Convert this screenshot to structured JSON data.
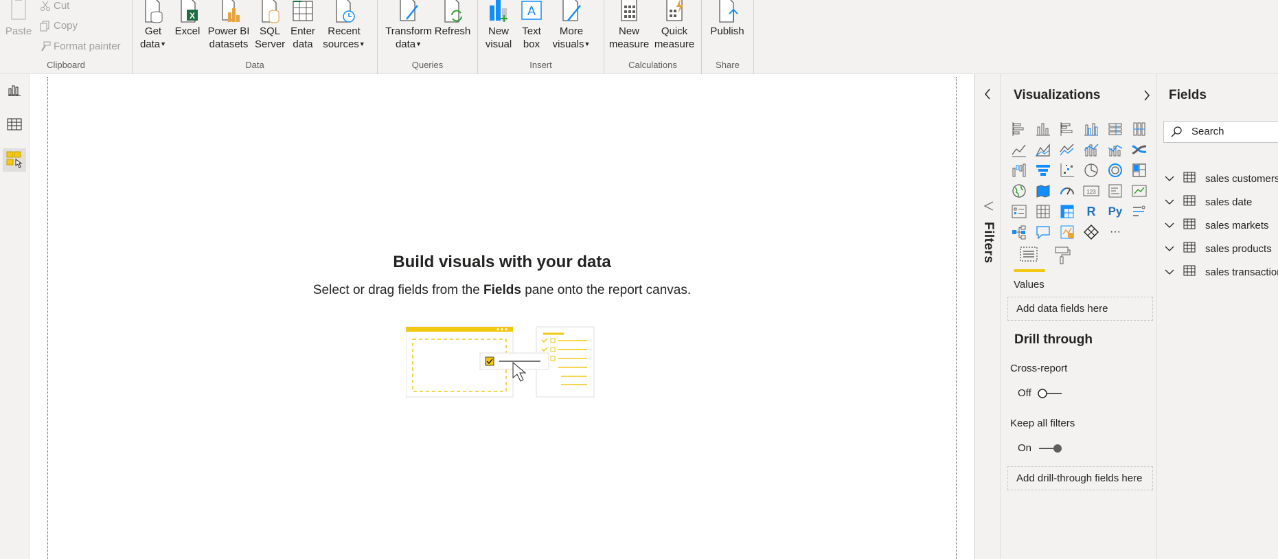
{
  "ribbon": {
    "clipboard": {
      "label": "Clipboard",
      "paste": "Paste",
      "cut": "Cut",
      "copy": "Copy",
      "format_painter": "Format painter"
    },
    "data": {
      "label": "Data",
      "get_data": "Get\ndata",
      "excel": "Excel",
      "power_bi_datasets": "Power BI\ndatasets",
      "sql_server": "SQL\nServer",
      "enter_data": "Enter\ndata",
      "recent_sources": "Recent\nsources"
    },
    "queries": {
      "label": "Queries",
      "transform_data": "Transform\ndata",
      "refresh": "Refresh"
    },
    "insert": {
      "label": "Insert",
      "new_visual": "New\nvisual",
      "text_box": "Text\nbox",
      "more_visuals": "More\nvisuals"
    },
    "calculations": {
      "label": "Calculations",
      "new_measure": "New\nmeasure",
      "quick_measure": "Quick\nmeasure"
    },
    "share": {
      "label": "Share",
      "publish": "Publish"
    }
  },
  "canvas": {
    "title": "Build visuals with your data",
    "subtitle_pre": "Select or drag fields from the ",
    "subtitle_bold": "Fields",
    "subtitle_post": " pane onto the report canvas."
  },
  "filters": {
    "title": "Filters"
  },
  "visualizations": {
    "title": "Visualizations",
    "values_label": "Values",
    "values_well": "Add data fields here",
    "drill_title": "Drill through",
    "cross_report_label": "Cross-report",
    "cross_report_state": "Off",
    "keep_filters_label": "Keep all filters",
    "keep_filters_state": "On",
    "drill_well": "Add drill-through fields here",
    "r_icon_text": "R",
    "py_icon_text": "Py",
    "card_icon_text": "123",
    "more_icon_text": "···"
  },
  "fields": {
    "title": "Fields",
    "search_placeholder": "Search",
    "tables": [
      "sales customers",
      "sales date",
      "sales markets",
      "sales products",
      "sales transactions"
    ]
  },
  "colors": {
    "accent_yellow": "#f2c811",
    "icon_blue": "#118dff",
    "excel_green": "#1d6f42"
  }
}
